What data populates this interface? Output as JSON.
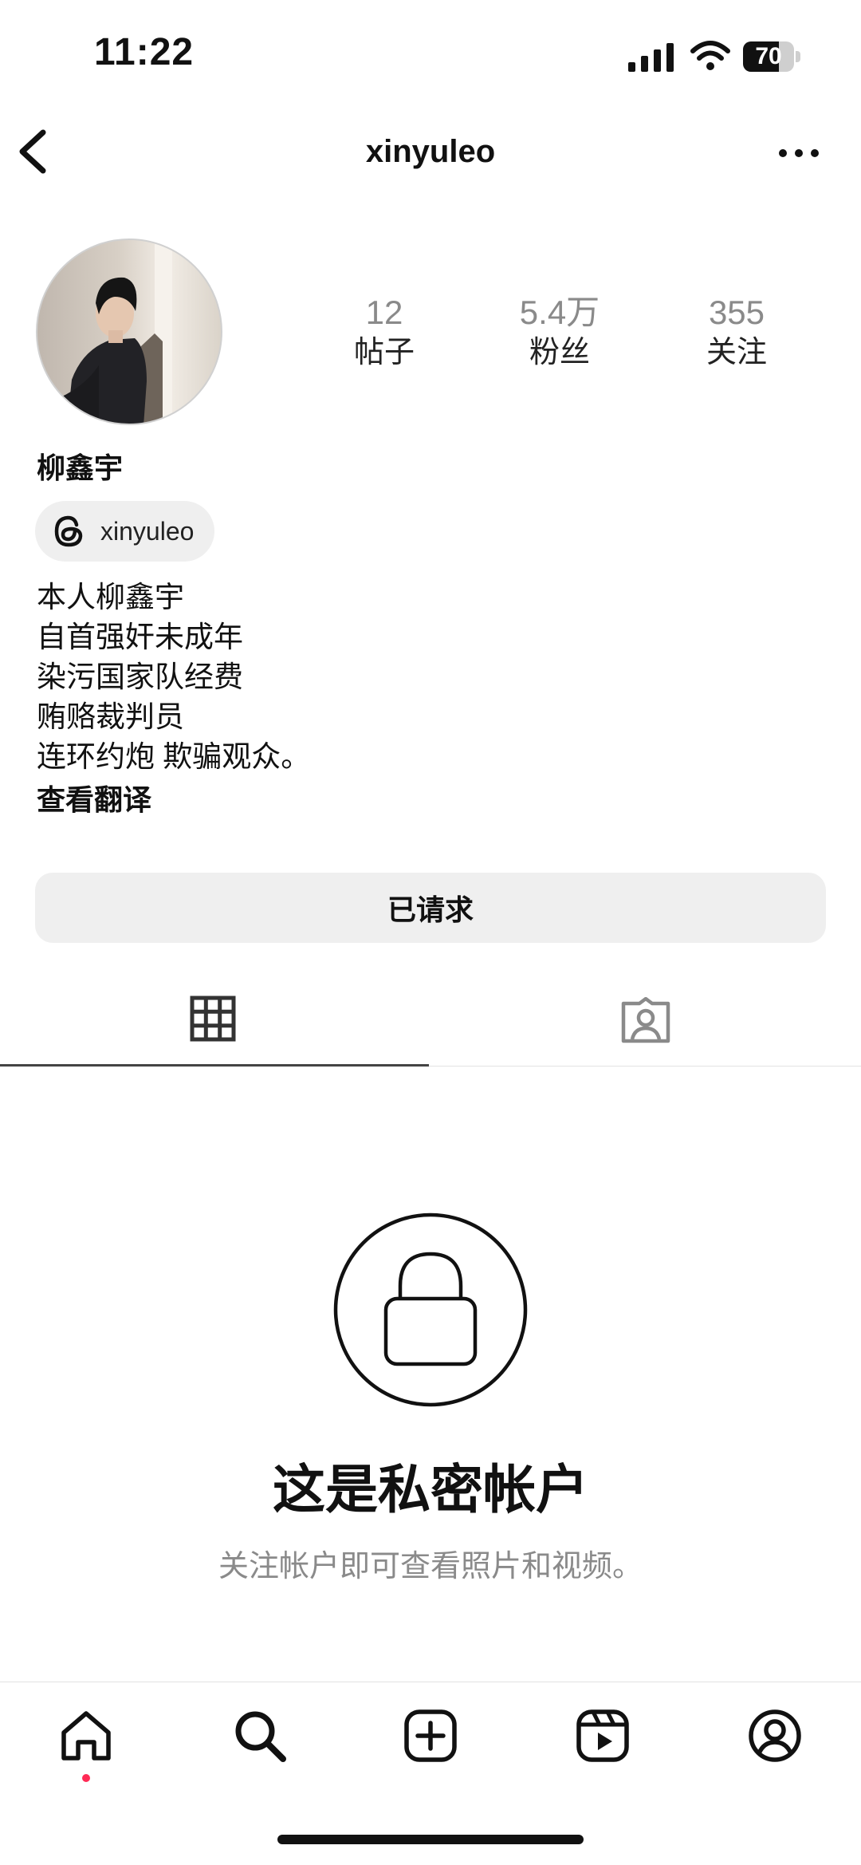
{
  "status_bar": {
    "time": "11:22",
    "battery": "70",
    "battery_level": 0.7
  },
  "header": {
    "username": "xinyuleo"
  },
  "profile": {
    "stats": [
      {
        "value": "12",
        "label": "帖子"
      },
      {
        "value": "5.4万",
        "label": "粉丝"
      },
      {
        "value": "355",
        "label": "关注"
      }
    ],
    "full_name": "柳鑫宇",
    "threads_handle": "xinyuleo",
    "bio_lines": [
      "本人柳鑫宇",
      "自首强奸未成年",
      "染污国家队经费",
      "贿赂裁判员",
      "连环约炮 欺骗观众。"
    ],
    "translate_label": "查看翻译",
    "request_button": "已请求"
  },
  "private": {
    "title": "这是私密帐户",
    "subtitle": "关注帐户即可查看照片和视频。"
  },
  "icons": {
    "back": "back-chevron-icon",
    "more": "more-icon",
    "grid": "grid-icon",
    "tagged": "tagged-icon",
    "lock": "lock-icon",
    "home": "home-icon",
    "search": "search-icon",
    "create": "create-icon",
    "reels": "reels-icon",
    "profile": "profile-icon"
  },
  "colors": {
    "notification_dot": "#ff2a55",
    "muted_text": "#8a8a8a",
    "button_bg": "#efefef"
  }
}
